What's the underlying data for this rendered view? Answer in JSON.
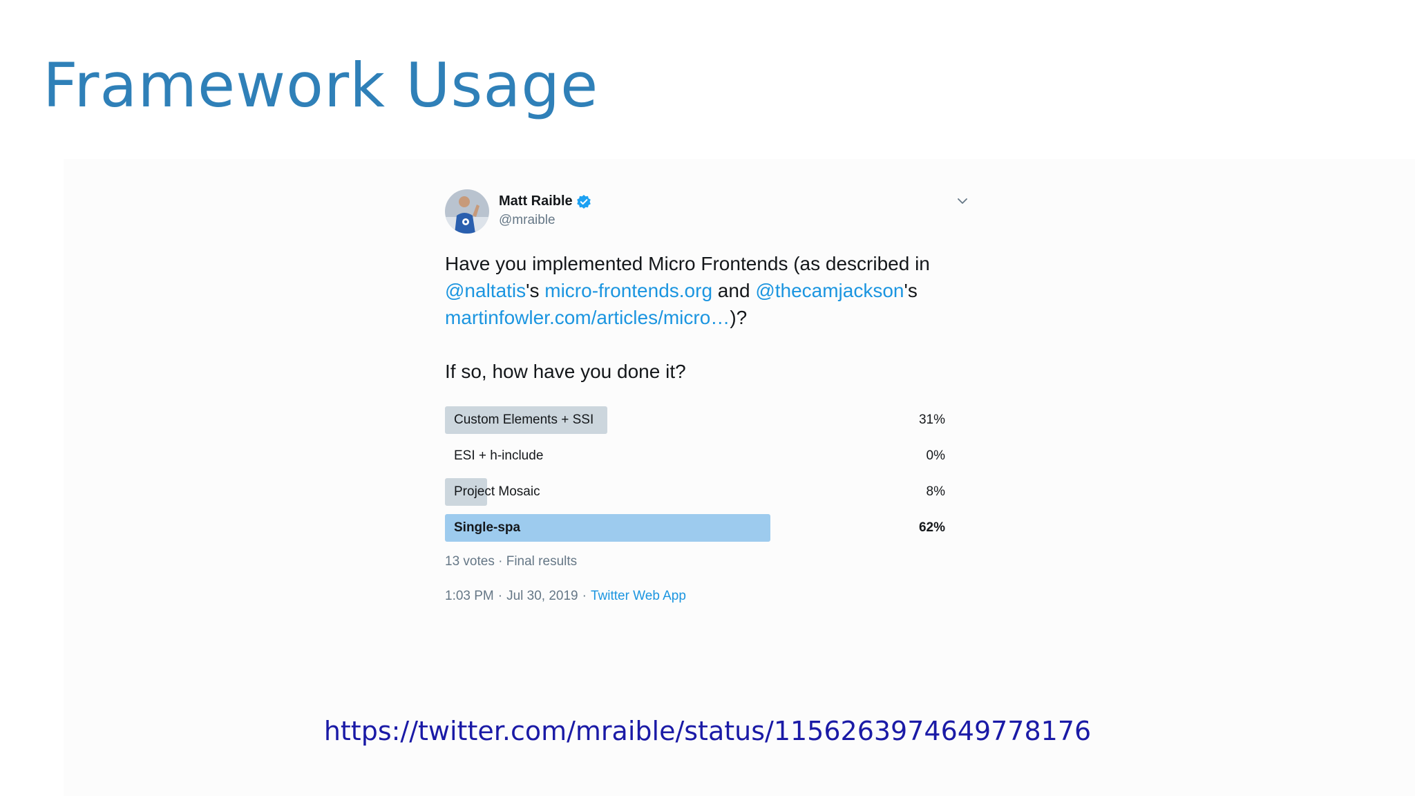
{
  "slide": {
    "title": "Framework Usage",
    "status_url": "https://twitter.com/mraible/status/1156263974649778176"
  },
  "tweet": {
    "author_name": "Matt Raible",
    "author_handle": "@mraible",
    "text": {
      "part1": "Have you implemented Micro Frontends (as described in ",
      "mention1": "@naltatis",
      "part2": "'s ",
      "link1": "micro-frontends.org",
      "part3": " and ",
      "mention2": "@thecamjackson",
      "part4": "'s ",
      "link2": "martinfowler.com/articles/micro…",
      "part5": ")?"
    },
    "question": "If so, how have you done it?",
    "poll": {
      "options": [
        {
          "label": "Custom Elements + SSI",
          "percent": "31%",
          "value": 31
        },
        {
          "label": "ESI + h-include",
          "percent": "0%",
          "value": 0
        },
        {
          "label": "Project Mosaic",
          "percent": "8%",
          "value": 8
        },
        {
          "label": "Single-spa",
          "percent": "62%",
          "value": 62
        }
      ],
      "meta": "13 votes · Final results"
    },
    "footer": {
      "time": "1:03 PM",
      "date": "Jul 30, 2019",
      "separator": "·",
      "source": "Twitter Web App"
    }
  },
  "colors": {
    "title": "#2f80b8",
    "link": "#1b95e0",
    "poll_fill": "#ccd6dd",
    "poll_winner_fill": "#9dcbee",
    "url": "#1a1aa6"
  },
  "icons": {
    "verified": "verified-badge-icon",
    "caret": "chevron-down-icon",
    "avatar": "avatar"
  }
}
